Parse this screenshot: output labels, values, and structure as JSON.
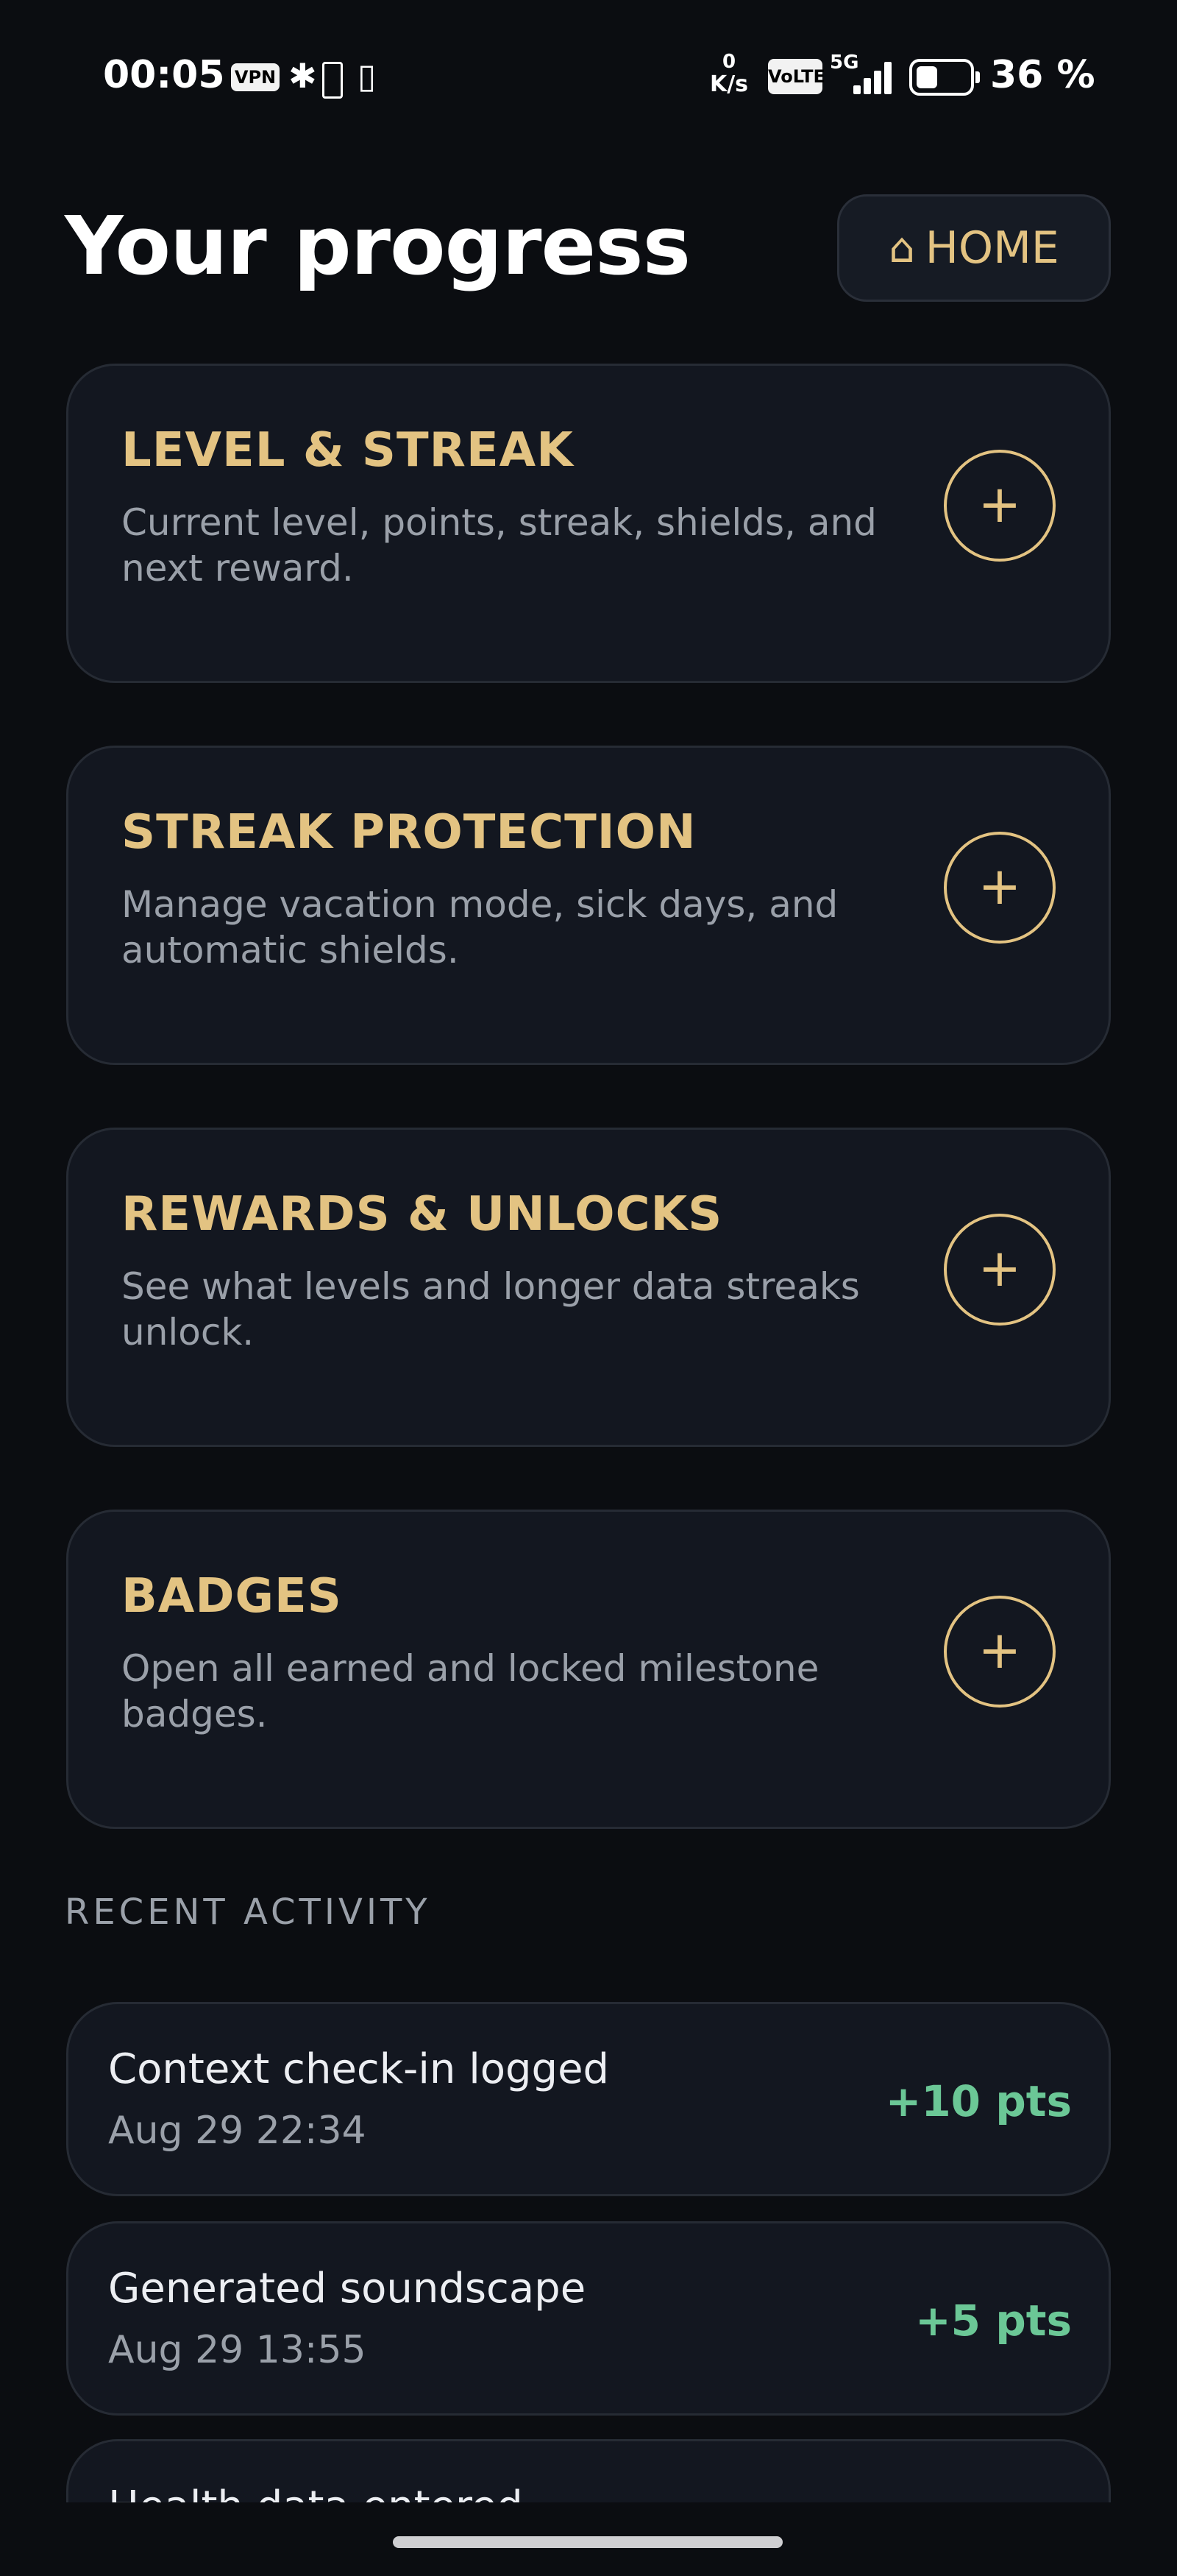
{
  "status_bar": {
    "time": "00:05",
    "vpn": "VPN",
    "net_speed_value": "0",
    "net_speed_unit": "K/s",
    "volte": "VoLTE",
    "network": "5G",
    "battery_percent": "36 %",
    "icons": [
      "vpn-icon",
      "bluetooth-icon",
      "battery-saver-icon",
      "vibrate-icon",
      "volte-icon",
      "signal-icon",
      "battery-icon"
    ]
  },
  "header": {
    "title": "Your progress",
    "home_icon": "⌂",
    "home_label": "HOME"
  },
  "cards": [
    {
      "title": "LEVEL & STREAK",
      "description": "Current level, points, streak, shields, and next reward.",
      "action": "+"
    },
    {
      "title": "STREAK PROTECTION",
      "description": "Manage vacation mode, sick days, and automatic shields.",
      "action": "+"
    },
    {
      "title": "REWARDS & UNLOCKS",
      "description": "See what levels and longer data streaks unlock.",
      "action": "+"
    },
    {
      "title": "BADGES",
      "description": "Open all earned and locked milestone badges.",
      "action": "+"
    }
  ],
  "recent_activity": {
    "label": "RECENT ACTIVITY",
    "items": [
      {
        "title": "Context check-in logged",
        "time": "Aug 29  22:34",
        "points": "+10 pts"
      },
      {
        "title": "Generated soundscape",
        "time": "Aug 29  13:55",
        "points": "+5 pts"
      },
      {
        "title": "Health data entered",
        "time": "",
        "points": ""
      }
    ]
  },
  "colors": {
    "background": "#0b0d11",
    "card": "#131720",
    "accent_gold": "#e3c382",
    "points_green": "#6bc796",
    "muted_text": "#9aa0a9"
  }
}
